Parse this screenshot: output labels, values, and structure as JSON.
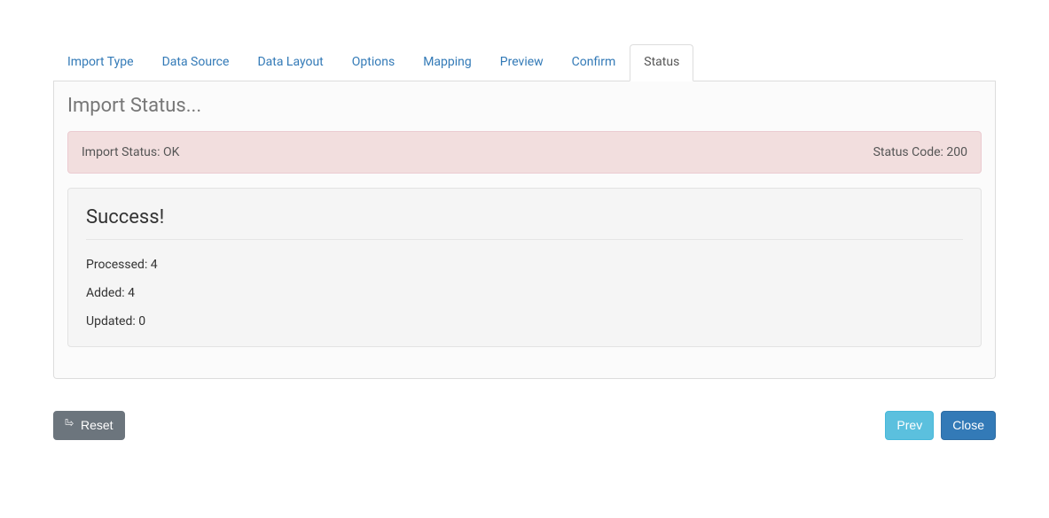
{
  "tabs": [
    {
      "label": "Import Type"
    },
    {
      "label": "Data Source"
    },
    {
      "label": "Data Layout"
    },
    {
      "label": "Options"
    },
    {
      "label": "Mapping"
    },
    {
      "label": "Preview"
    },
    {
      "label": "Confirm"
    },
    {
      "label": "Status"
    }
  ],
  "panel": {
    "title": "Import Status..."
  },
  "alert": {
    "status_text": "Import Status: OK",
    "status_code_text": "Status Code: 200"
  },
  "result": {
    "title": "Success!",
    "processed_text": "Processed: 4",
    "added_text": "Added: 4",
    "updated_text": "Updated: 0"
  },
  "buttons": {
    "reset_label": "Reset",
    "prev_label": "Prev",
    "close_label": "Close"
  }
}
